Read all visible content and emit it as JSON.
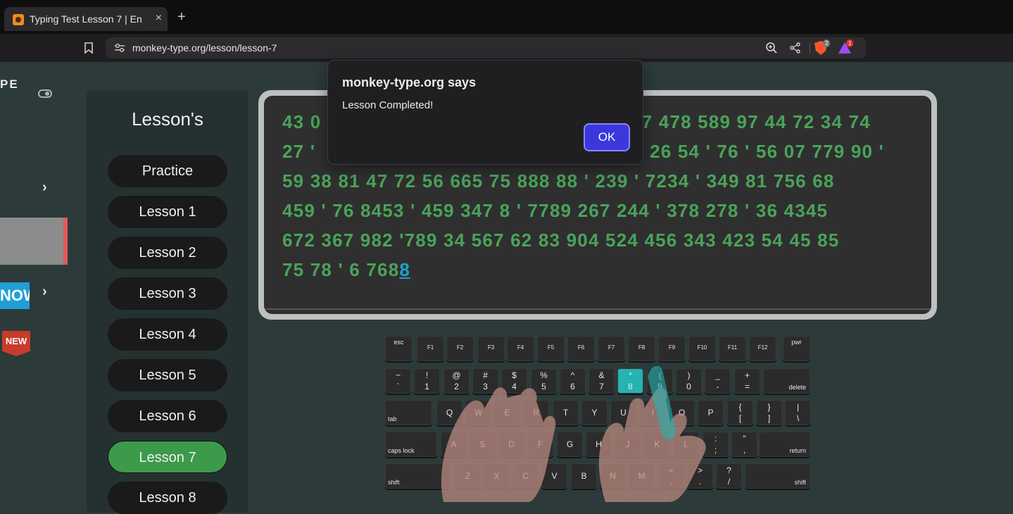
{
  "browser": {
    "tab_title": "Typing Test Lesson 7 | En",
    "tab_close": "×",
    "new_tab": "+",
    "url": "monkey-type.org/lesson/lesson-7",
    "shields_badge": "2",
    "rewards_badge": "1"
  },
  "sidebar": {
    "logo_fragment": "PE",
    "now_banner": "NOW",
    "new_badge": "NEW",
    "chevron": "›"
  },
  "lessons_panel": {
    "heading": "Lesson's",
    "items": [
      "Practice",
      "Lesson 1",
      "Lesson 2",
      "Lesson 3",
      "Lesson 4",
      "Lesson 5",
      "Lesson 6",
      "Lesson 7",
      "Lesson 8"
    ],
    "active": "Lesson 7"
  },
  "typing_text": {
    "lines": [
      "43 0",
      "27 '",
      "59 38 81 47 72 56 665 75 888 88 ' 239 ' 7234 ' 349 81 756 68",
      "459 ' 76 8453 ' 459 347 8 ' 7789 267 244 ' 378 278 ' 36 4345",
      "672 367 982 '789 34 567 62 83 904 524 456 343 423 54 45 85",
      "75 78 ' 6 768"
    ],
    "line1_right": "67 478 589 97 44 72 34 74",
    "line2_right": "3 26 54 ' 76 ' 56 07 779 90 '",
    "cursor_char": "8",
    "colors": {
      "typed": "#4aa35a",
      "cursor": "#1ea0c8"
    }
  },
  "dialog": {
    "title": "monkey-type.org says",
    "message": "Lesson Completed!",
    "ok_label": "OK"
  },
  "keyboard": {
    "highlighted_key": "*/8",
    "fn_row": [
      "esc",
      "F1",
      "F2",
      "F3",
      "F4",
      "F5",
      "F6",
      "F7",
      "F8",
      "F9",
      "F10",
      "F11",
      "F12",
      "pwr"
    ],
    "num_row": [
      [
        "~",
        "`"
      ],
      [
        "!",
        "1"
      ],
      [
        "@",
        "2"
      ],
      [
        "#",
        "3"
      ],
      [
        "$",
        "4"
      ],
      [
        "%",
        "5"
      ],
      [
        "^",
        "6"
      ],
      [
        "&",
        "7"
      ],
      [
        "*",
        "8"
      ],
      [
        "(",
        "9"
      ],
      [
        ")",
        "0"
      ],
      [
        "_",
        "-"
      ],
      [
        "+",
        "="
      ]
    ],
    "delete_label": "delete",
    "tab_label": "tab",
    "q_row": [
      "Q",
      "W",
      "E",
      "R",
      "T",
      "Y",
      "U",
      "I",
      "O",
      "P"
    ],
    "q_row_sym": [
      [
        "{",
        "["
      ],
      [
        "}",
        "]"
      ],
      [
        "|",
        "\\"
      ]
    ],
    "caps_label": "caps lock",
    "a_row": [
      "A",
      "S",
      "D",
      "F",
      "G",
      "H",
      "J",
      "K",
      "L"
    ],
    "a_row_sym": [
      [
        ":",
        ";"
      ],
      [
        "\"",
        ","
      ]
    ],
    "return_label": "return",
    "shift_label": "shift",
    "z_row": [
      "Z",
      "X",
      "C",
      "V",
      "B",
      "N",
      "M"
    ],
    "z_row_sym": [
      [
        "<",
        ","
      ],
      [
        ">",
        "."
      ],
      [
        "?",
        "/"
      ]
    ]
  }
}
